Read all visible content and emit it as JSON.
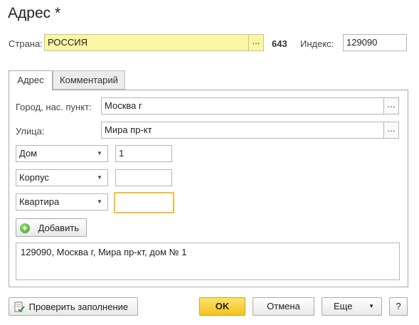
{
  "window": {
    "title": "Адрес *"
  },
  "country": {
    "label": "Страна:",
    "value": "РОССИЯ",
    "code": "643",
    "select_label": "..."
  },
  "index": {
    "label": "Индекс:",
    "value": "129090"
  },
  "tabs": [
    {
      "label": "Адрес",
      "active": true
    },
    {
      "label": "Комментарий",
      "active": false
    }
  ],
  "city": {
    "label": "Город, нас. пункт:",
    "value": "Москва г",
    "select_label": "..."
  },
  "street": {
    "label": "Улица:",
    "value": "Мира пр-кт",
    "select_label": "..."
  },
  "building_rows": [
    {
      "type": "Дом",
      "value": "1"
    },
    {
      "type": "Корпус",
      "value": ""
    },
    {
      "type": "Квартира",
      "value": ""
    }
  ],
  "dropdown_arrow": "▼",
  "add_button": {
    "label": "Добавить",
    "icon": "plus-circle-icon",
    "icon_glyph": "+"
  },
  "address_preview": "129090, Москва г, Мира пр-кт, дом № 1",
  "footer": {
    "check_button": "Проверить заполнение",
    "check_icon": "check-document-icon",
    "ok_button": "OK",
    "cancel_button": "Отмена",
    "more_button": "Еще",
    "help_button": "?"
  },
  "colors": {
    "highlight_field": "#fbf6a4",
    "focus_border": "#f3c035",
    "ok_button": "#f3c21e"
  }
}
